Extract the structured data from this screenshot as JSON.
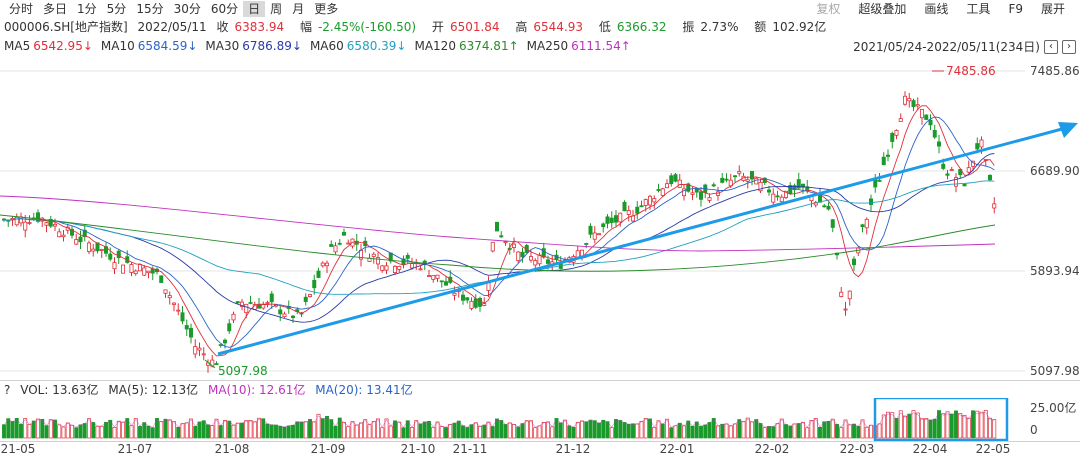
{
  "toolbar": {
    "tabs": [
      "分时",
      "多日",
      "1分",
      "5分",
      "15分",
      "30分",
      "60分",
      "日",
      "周",
      "月",
      "更多"
    ],
    "active_tab": "日",
    "right_tools": [
      "复权",
      "超级叠加",
      "画线",
      "工具",
      "F9",
      "展开"
    ]
  },
  "quote": {
    "code": "000006.SH[地产指数]",
    "date": "2022/05/11",
    "close_label": "收",
    "close": "6383.94",
    "change_label": "幅",
    "change": "-2.45%(-160.50)",
    "open_label": "开",
    "open": "6501.84",
    "high_label": "高",
    "high": "6544.93",
    "low_label": "低",
    "low": "6366.32",
    "amp_label": "振",
    "amp": "2.73%",
    "amount_label": "额",
    "amount": "102.92亿"
  },
  "ma": [
    {
      "label": "MA5",
      "value": "6542.95↓",
      "color": "#e0303a"
    },
    {
      "label": "MA10",
      "value": "6584.59↓",
      "color": "#2a64c8"
    },
    {
      "label": "MA30",
      "value": "6786.89↓",
      "color": "#2a3aa8"
    },
    {
      "label": "MA60",
      "value": "6580.39↓",
      "color": "#20a0c0"
    },
    {
      "label": "MA120",
      "value": "6374.81↑",
      "color": "#2a8a2a"
    },
    {
      "label": "MA250",
      "value": "6111.54↑",
      "color": "#c030c0"
    }
  ],
  "range": {
    "text": "2021/05/24-2022/05/11(234日)",
    "btn_left": "‹",
    "btn_right": "›"
  },
  "price_axis": [
    "7485.86",
    "6689.90",
    "5893.94",
    "5097.98"
  ],
  "annotations": {
    "high": "7485.86",
    "low": "5097.98"
  },
  "volume": {
    "title": "VOL: 13.63亿",
    "ma5": "MA(5): 12.13亿",
    "ma10": "MA(10): 12.61亿",
    "ma20": "MA(20): 13.41亿",
    "help": "?",
    "axis": [
      "25.00亿",
      "0"
    ]
  },
  "x_axis": [
    "21-05",
    "21-07",
    "21-08",
    "21-09",
    "21-10",
    "21-11",
    "21-12",
    "22-01",
    "22-02",
    "22-03",
    "22-04",
    "22-05"
  ],
  "colors": {
    "up": "#e0303a",
    "down": "#1a9a2a",
    "trend": "#1e9be8"
  }
}
